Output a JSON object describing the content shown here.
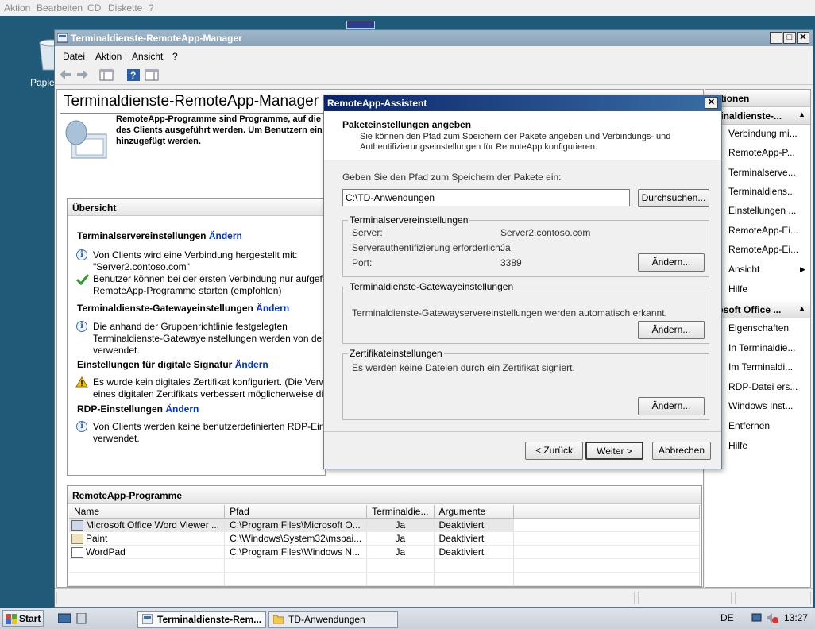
{
  "host_menu": [
    "Aktion",
    "Bearbeiten",
    "CD",
    "Diskette",
    "?"
  ],
  "desktop": {
    "recycle_label": "Papie"
  },
  "window": {
    "title": "Terminaldienste-RemoteApp-Manager",
    "menu": [
      "Datei",
      "Aktion",
      "Ansicht",
      "?"
    ],
    "page_title": "Terminaldienste-RemoteApp-Manager",
    "intro": [
      "RemoteApp-Programme sind Programme, auf die",
      "des Clients ausgeführt werden. Um Benutzern ein I",
      "hinzugefügt werden."
    ],
    "overview": {
      "header": "Übersicht",
      "sections": [
        {
          "title": "Terminalservereinstellungen",
          "link": "Ändern",
          "items": [
            {
              "icon": "info-icon",
              "lines": [
                "Von Clients wird eine Verbindung hergestellt mit:",
                "\"Server2.contoso.com\""
              ]
            },
            {
              "icon": "check-icon",
              "lines": [
                "Benutzer können bei der ersten Verbindung nur aufgefü",
                "RemoteApp-Programme starten (empfohlen)"
              ]
            }
          ]
        },
        {
          "title": "Terminaldienste-Gatewayeinstellungen",
          "link": "Ändern",
          "items": [
            {
              "icon": "info-icon",
              "lines": [
                "Die anhand der Gruppenrichtlinie festgelegten",
                "Terminaldienste-Gatewayeinstellungen werden von der",
                "verwendet."
              ]
            }
          ]
        },
        {
          "title": "Einstellungen für digitale Signatur",
          "link": "Ändern",
          "items": [
            {
              "icon": "warning-icon",
              "lines": [
                "Es wurde kein digitales Zertifikat konfiguriert. (Die Verw",
                "eines digitalen Zertifikats verbessert möglicherweise die"
              ]
            }
          ]
        },
        {
          "title": "RDP-Einstellungen",
          "link": "Ändern",
          "items": [
            {
              "icon": "info-icon",
              "lines": [
                "Von Clients werden keine benutzerdefinierten RDP-Einst",
                "verwendet."
              ]
            }
          ]
        }
      ]
    },
    "programs": {
      "header": "RemoteApp-Programme",
      "columns": [
        "Name",
        "Pfad",
        "Terminaldie...",
        "Argumente"
      ],
      "rows": [
        [
          "Microsoft Office Word Viewer ...",
          "C:\\Program Files\\Microsoft O...",
          "Ja",
          "Deaktiviert"
        ],
        [
          "Paint",
          "C:\\Windows\\System32\\mspai...",
          "Ja",
          "Deaktiviert"
        ],
        [
          "WordPad",
          "C:\\Program Files\\Windows N...",
          "Ja",
          "Deaktiviert"
        ]
      ]
    },
    "actions": {
      "header": "Aktionen",
      "group1": "rminaldienste-...",
      "items1": [
        "Verbindung mi...",
        "RemoteApp-P...",
        "Terminalserve...",
        "Terminaldiens...",
        "Einstellungen ...",
        "RemoteApp-Ei...",
        "RemoteApp-Ei...",
        "Ansicht",
        "Hilfe"
      ],
      "group2": "crosoft Office ...",
      "items2": [
        "Eigenschaften",
        "In Terminaldie...",
        "Im Terminaldi...",
        "RDP-Datei ers...",
        "Windows Inst...",
        "Entfernen",
        "Hilfe"
      ]
    }
  },
  "dialog": {
    "title": "RemoteApp-Assistent",
    "heading": "Paketeinstellungen angeben",
    "subheading": [
      "Sie können den Pfad zum Speichern der Pakete angeben und Verbindungs- und",
      "Authentifizierungseinstellungen für RemoteApp konfigurieren."
    ],
    "path_label": "Geben Sie den Pfad zum Speichern der Pakete ein:",
    "path_value": "C:\\TD-Anwendungen",
    "browse": "Durchsuchen...",
    "ts_group": "Terminalservereinstellungen",
    "server_label": "Server:",
    "server_value": "Server2.contoso.com",
    "auth_label": "Serverauthentifizierung erforderlich:",
    "auth_value": "Ja",
    "port_label": "Port:",
    "port_value": "3389",
    "change": "Ändern...",
    "gw_group": "Terminaldienste-Gatewayeinstellungen",
    "gw_text": "Terminaldienste-Gatewayservereinstellungen werden automatisch erkannt.",
    "cert_group": "Zertifikateinstellungen",
    "cert_text": "Es werden keine Dateien durch ein Zertifikat signiert.",
    "back": "< Zurück",
    "next": "Weiter >",
    "cancel": "Abbrechen"
  },
  "taskbar": {
    "start": "Start",
    "tasks": [
      "Terminaldienste-Rem...",
      "TD-Anwendungen"
    ],
    "lang": "DE",
    "clock": "13:27"
  }
}
